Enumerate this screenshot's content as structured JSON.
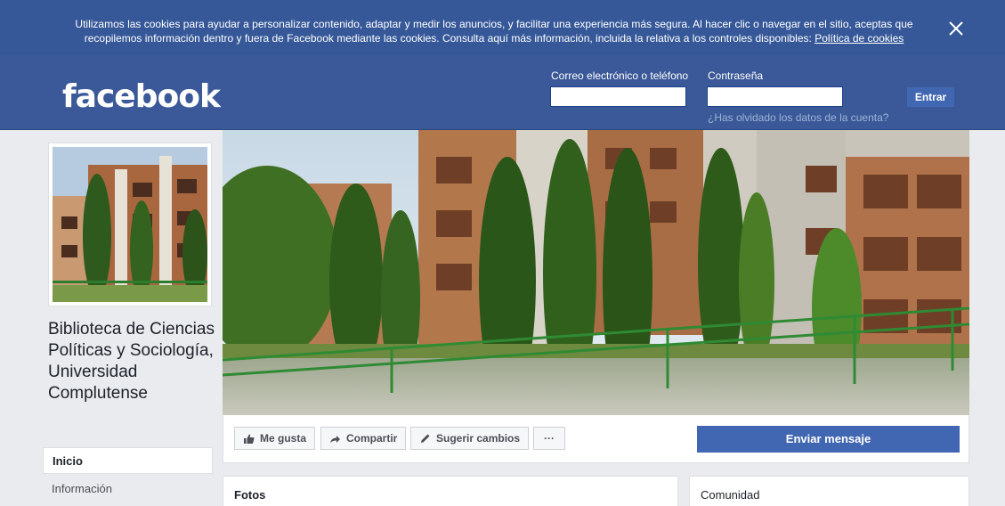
{
  "cookie_banner": {
    "line1": "Utilizamos las cookies para ayudar a personalizar contenido, adaptar y medir los anuncios, y facilitar una experiencia más segura. Al hacer clic o navegar en el sitio, aceptas que",
    "line2": "recopilemos información dentro y fuera de Facebook mediante las cookies. Consulta aquí más información, incluida la relativa a los controles disponibles:",
    "link": "Política de cookies",
    "close_icon": "close-icon"
  },
  "header": {
    "logo": "facebook",
    "email_label": "Correo electrónico o teléfono",
    "password_label": "Contraseña",
    "email_value": "",
    "password_value": "",
    "login_button": "Entrar",
    "forgot_link": "¿Has olvidado los datos de la cuenta?"
  },
  "page": {
    "name": "Biblioteca de Ciencias Políticas y Sociología, Universidad Complutense"
  },
  "nav": {
    "items": [
      {
        "label": "Inicio",
        "active": true
      },
      {
        "label": "Información",
        "active": false
      }
    ]
  },
  "actions": {
    "like": {
      "label": "Me gusta",
      "icon": "thumbs-up-icon"
    },
    "share": {
      "label": "Compartir",
      "icon": "share-arrow-icon"
    },
    "suggest": {
      "label": "Sugerir cambios",
      "icon": "pencil-icon"
    },
    "more": {
      "label": "···",
      "icon": "more-icon"
    },
    "send_message": "Enviar mensaje"
  },
  "cards": {
    "photos_title": "Fotos",
    "community_title": "Comunidad"
  },
  "colors": {
    "brand_blue": "#3b5998",
    "banner_blue": "#365899",
    "button_blue": "#4267b2",
    "background": "#e9ebee"
  }
}
